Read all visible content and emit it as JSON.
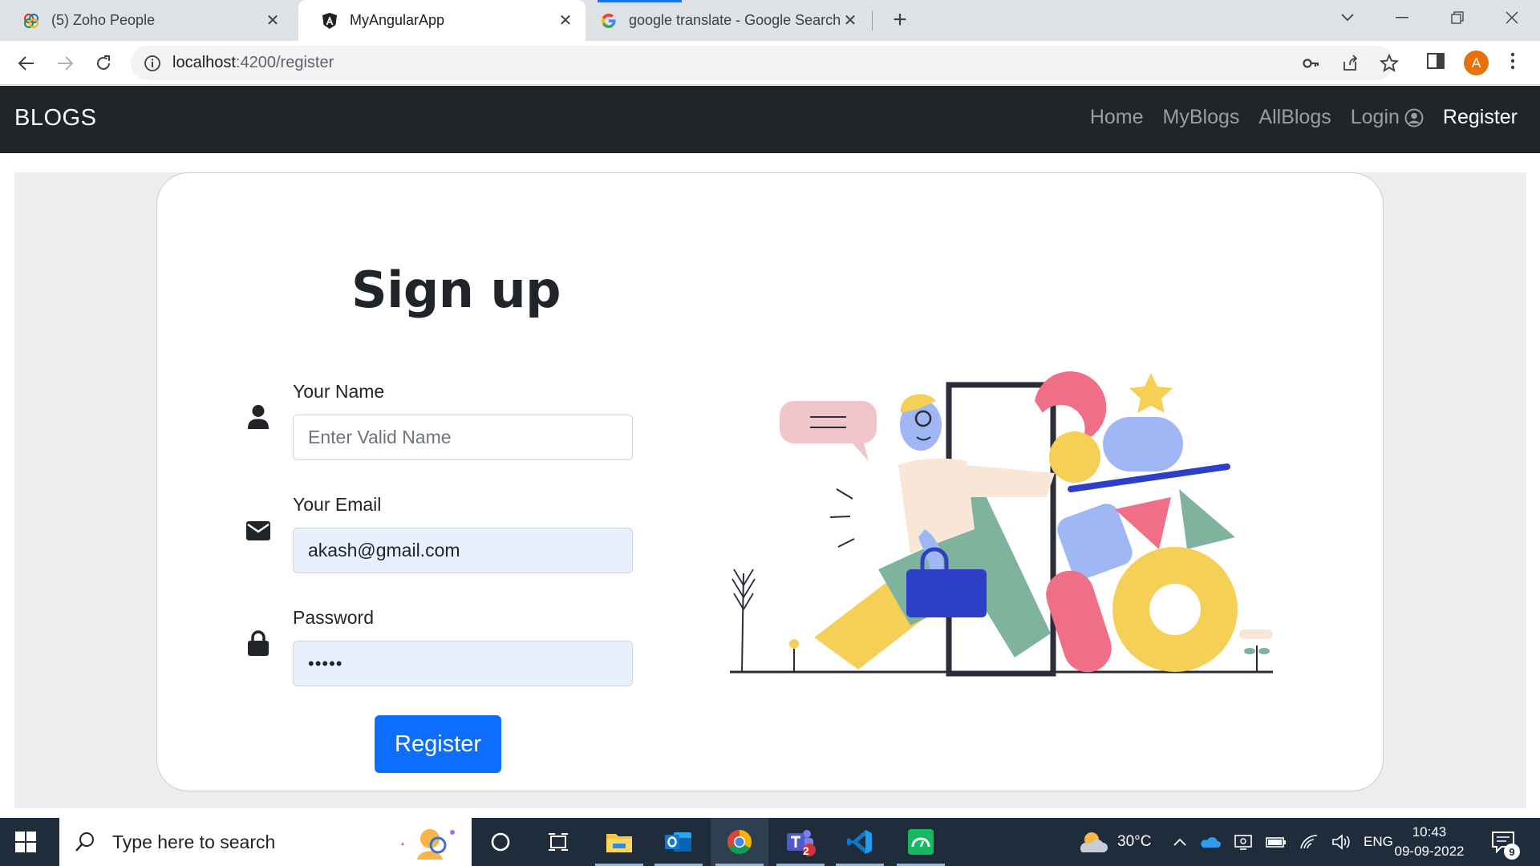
{
  "browser": {
    "tabs": [
      {
        "title": "(5) Zoho People",
        "icon": "zoho-icon"
      },
      {
        "title": "MyAngularApp",
        "icon": "angular-icon",
        "active": true
      },
      {
        "title": "google translate - Google Search",
        "icon": "google-icon"
      }
    ],
    "url_host": "localhost",
    "url_path": ":4200/register",
    "profile_initial": "A",
    "colors": {
      "tabstrip": "#dee1e6",
      "profile": "#e8710a"
    }
  },
  "navbar": {
    "brand": "BLOGS",
    "links": [
      {
        "label": "Home"
      },
      {
        "label": "MyBlogs"
      },
      {
        "label": "AllBlogs"
      },
      {
        "label": "Login",
        "icon": "user-circle-icon"
      },
      {
        "label": "Register",
        "active": true
      }
    ],
    "colors": {
      "background": "#212529"
    }
  },
  "form": {
    "heading": "Sign up",
    "name": {
      "label": "Your Name",
      "placeholder": "Enter Valid Name",
      "value": "",
      "icon": "user-icon"
    },
    "email": {
      "label": "Your Email",
      "value": "akash@gmail.com",
      "icon": "envelope-icon"
    },
    "password": {
      "label": "Password",
      "value": "•••••",
      "icon": "lock-icon"
    },
    "submit_label": "Register",
    "colors": {
      "button": "#0d6efd",
      "autofill": "#e8f0fe"
    }
  },
  "taskbar": {
    "search_placeholder": "Type here to search",
    "weather": "30°C",
    "language": "ENG",
    "time": "10:43",
    "date": "09-09-2022",
    "notification_count": "9",
    "teams_badge": "2",
    "apps": [
      "cortana-icon",
      "task-view-icon",
      "file-explorer-icon",
      "outlook-icon",
      "chrome-icon",
      "teams-icon",
      "vscode-icon",
      "cloud-app-icon"
    ]
  }
}
